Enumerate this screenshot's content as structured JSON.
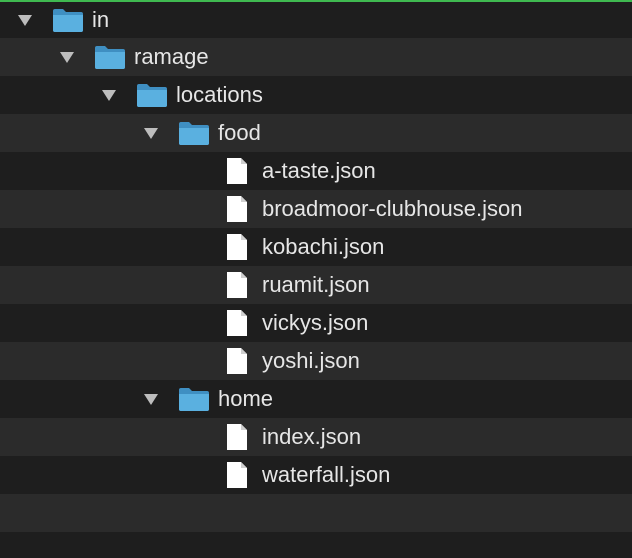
{
  "tree": {
    "root": {
      "label": "in",
      "expanded": true
    },
    "ramage": {
      "label": "ramage",
      "expanded": true
    },
    "locations": {
      "label": "locations",
      "expanded": true
    },
    "food": {
      "label": "food",
      "expanded": true,
      "files": [
        "a-taste.json",
        "broadmoor-clubhouse.json",
        "kobachi.json",
        "ruamit.json",
        "vickys.json",
        "yoshi.json"
      ]
    },
    "home": {
      "label": "home",
      "expanded": true,
      "files": [
        "index.json",
        "waterfall.json"
      ]
    }
  },
  "colors": {
    "folder": "#5ab0e0",
    "folder_dark": "#3f8fc2",
    "file": "#ffffff",
    "text": "#e6e6e6",
    "row_alt": "#2b2b2b",
    "background": "#1e1e1e",
    "top_border": "#3fb950"
  },
  "icons": {
    "folder": "folder-icon",
    "file": "file-icon",
    "disclosure_open": "disclosure-triangle-down-icon"
  }
}
